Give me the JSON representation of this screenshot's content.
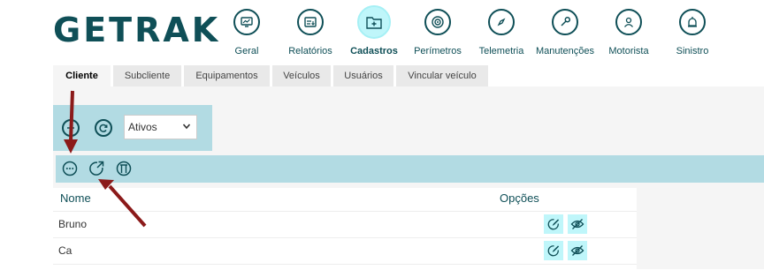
{
  "brand": {
    "logo_text": "GETRAK"
  },
  "topnav": {
    "items": [
      {
        "label": "Geral",
        "icon": "chart-icon",
        "active": false
      },
      {
        "label": "Relatórios",
        "icon": "report-icon",
        "active": false
      },
      {
        "label": "Cadastros",
        "icon": "folder-add-icon",
        "active": true
      },
      {
        "label": "Perímetros",
        "icon": "target-icon",
        "active": false
      },
      {
        "label": "Telemetria",
        "icon": "compass-icon",
        "active": false
      },
      {
        "label": "Manutenções",
        "icon": "wrench-icon",
        "active": false
      },
      {
        "label": "Motorista",
        "icon": "driver-icon",
        "active": false
      },
      {
        "label": "Sinistro",
        "icon": "alarm-icon",
        "active": false
      }
    ]
  },
  "tabs": [
    {
      "label": "Cliente",
      "active": true
    },
    {
      "label": "Subcliente",
      "active": false
    },
    {
      "label": "Equipamentos",
      "active": false
    },
    {
      "label": "Veículos",
      "active": false
    },
    {
      "label": "Usuários",
      "active": false
    },
    {
      "label": "Vincular veículo",
      "active": false
    }
  ],
  "filter": {
    "status_value": "Ativos"
  },
  "table": {
    "columns": {
      "name": "Nome",
      "options": "Opções"
    },
    "rows": [
      {
        "name": "Bruno"
      },
      {
        "name": "Ca"
      }
    ]
  },
  "colors": {
    "brand": "#0f4f57",
    "toolbar": "#b2dbe3",
    "highlight": "#bff6fa",
    "arrow": "#8b1a1a"
  }
}
